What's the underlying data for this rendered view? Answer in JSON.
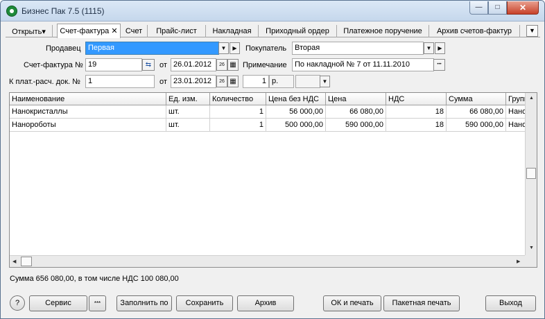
{
  "window": {
    "title": "Бизнес Пак 7.5 (1115)",
    "controls": {
      "minimize": "—",
      "maximize": "□",
      "close": "✕"
    }
  },
  "tabs": [
    {
      "label": "Открыть▾"
    },
    {
      "label": "Счет-фактура ✕"
    },
    {
      "label": "Счет"
    },
    {
      "label": "Прайс-лист"
    },
    {
      "label": "Накладная"
    },
    {
      "label": "Приходный ордер"
    },
    {
      "label": "Платежное поручение"
    },
    {
      "label": "Архив счетов-фактур"
    }
  ],
  "tab_scroll": "▼",
  "form": {
    "seller_label": "Продавец",
    "seller_value": "Первая",
    "buyer_label": "Покупатель",
    "buyer_value": "Вторая",
    "invoice_label": "Счет-фактура №",
    "invoice_number": "19",
    "date_label": "от",
    "invoice_date": "26.01.2012",
    "note_label": "Примечание",
    "note_value": "По накладной № 7 от 11.11.2010",
    "payment_label": "К плат.-расч. док. №",
    "payment_number": "1",
    "payment_date_label": "от",
    "payment_date": "23.01.2012",
    "rate_value": "1",
    "currency_value": "р.",
    "currency_alt": ""
  },
  "icons": {
    "dropdown": "▼",
    "arrow_right": "▶",
    "calendar_day": "26",
    "calendar": "▦",
    "ellipsis": "•••",
    "swap": "⇆"
  },
  "table": {
    "columns": [
      "Наименование",
      "Ед. изм.",
      "Количество",
      "Цена без НДС",
      "Цена",
      "НДС",
      "Сумма",
      "Группа"
    ],
    "rows": [
      [
        "Нанокристаллы",
        "шт.",
        "1",
        "56 000,00",
        "66 080,00",
        "18",
        "66 080,00",
        "Наноиз"
      ],
      [
        "Нанороботы",
        "шт.",
        "1",
        "500 000,00",
        "590 000,00",
        "18",
        "590 000,00",
        "Наноиз"
      ]
    ]
  },
  "scroll": {
    "up": "▲",
    "down": "▼",
    "left": "◀",
    "right": "▶"
  },
  "status_text": "Сумма 656 080,00, в том числе НДС 100 080,00",
  "buttons": {
    "help": "?",
    "service": "Сервис",
    "more": "***",
    "fill_by": "Заполнить по",
    "save": "Сохранить",
    "archive": "Архив",
    "ok_print": "ОК и печать",
    "batch_print": "Пакетная печать",
    "exit": "Выход"
  }
}
